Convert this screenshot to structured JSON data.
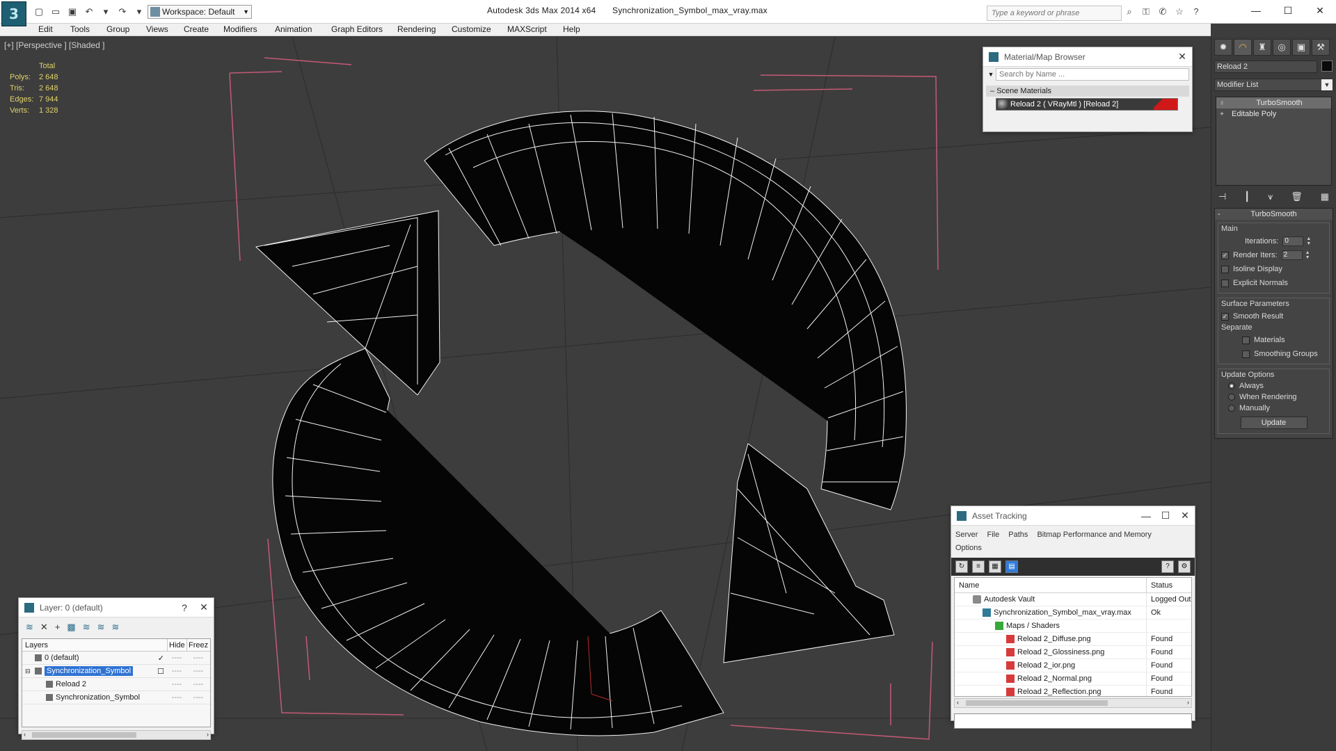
{
  "window": {
    "app_title": "Autodesk 3ds Max  2014 x64",
    "file_title": "Synchronization_Symbol_max_vray.max",
    "workspace_label": "Workspace: Default",
    "search_placeholder": "Type a keyword or phrase",
    "minimize": "—",
    "maximize": "☐",
    "close": "✕"
  },
  "menu": [
    "Edit",
    "Tools",
    "Group",
    "Views",
    "Create",
    "Modifiers",
    "Animation",
    "Graph Editors",
    "Rendering",
    "Customize",
    "MAXScript",
    "Help"
  ],
  "viewport": {
    "label": "[+] [Perspective ] [Shaded ]",
    "stats_header": "Total",
    "stats": [
      {
        "label": "Polys:",
        "value": "2 648"
      },
      {
        "label": "Tris:",
        "value": "2 648"
      },
      {
        "label": "Edges:",
        "value": "7 944"
      },
      {
        "label": "Verts:",
        "value": "1 328"
      }
    ]
  },
  "material_browser": {
    "title": "Material/Map Browser",
    "search_placeholder": "Search by Name ...",
    "section": "Scene Materials",
    "item": "Reload 2  ( VRayMtl )  [Reload 2]"
  },
  "command_panel": {
    "object_name": "Reload 2",
    "modifier_list": "Modifier List",
    "stack": [
      "TurboSmooth",
      "Editable Poly"
    ],
    "rollout_title": "TurboSmooth",
    "main_group": "Main",
    "iterations_label": "Iterations:",
    "iterations_value": "0",
    "render_iters_label": "Render Iters:",
    "render_iters_value": "2",
    "render_iters_checked": true,
    "isoline_display": "Isoline Display",
    "explicit_normals": "Explicit Normals",
    "surface_group": "Surface Parameters",
    "smooth_result": "Smooth Result",
    "separate_label": "Separate",
    "materials": "Materials",
    "smoothing_groups": "Smoothing Groups",
    "update_group": "Update Options",
    "always": "Always",
    "when_rendering": "When Rendering",
    "manually": "Manually",
    "update_button": "Update"
  },
  "layer_panel": {
    "title": "Layer: 0 (default)",
    "help": "?",
    "close": "✕",
    "col_layers": "Layers",
    "col_hide": "Hide",
    "col_freeze": "Freez",
    "rows": [
      {
        "name": "0 (default)",
        "indent": 0,
        "selected": false,
        "check": "✓"
      },
      {
        "name": "Synchronization_Symbol",
        "indent": 0,
        "selected": true,
        "check": "☐"
      },
      {
        "name": "Reload 2",
        "indent": 1,
        "selected": false,
        "check": ""
      },
      {
        "name": "Synchronization_Symbol",
        "indent": 1,
        "selected": false,
        "check": ""
      }
    ],
    "dash": "----"
  },
  "asset_tracking": {
    "title": "Asset Tracking",
    "menu": [
      "Server",
      "File",
      "Paths",
      "Bitmap Performance and Memory",
      "Options"
    ],
    "col_name": "Name",
    "col_status": "Status",
    "rows": [
      {
        "name": "Autodesk Vault",
        "status": "Logged Out",
        "indent": 1,
        "icon": "vault"
      },
      {
        "name": "Synchronization_Symbol_max_vray.max",
        "status": "Ok",
        "indent": 2,
        "icon": "max"
      },
      {
        "name": "Maps / Shaders",
        "status": "",
        "indent": 3,
        "icon": "maps"
      },
      {
        "name": "Reload 2_Diffuse.png",
        "status": "Found",
        "indent": 4,
        "icon": "png"
      },
      {
        "name": "Reload 2_Glossiness.png",
        "status": "Found",
        "indent": 4,
        "icon": "png"
      },
      {
        "name": "Reload 2_ior.png",
        "status": "Found",
        "indent": 4,
        "icon": "png"
      },
      {
        "name": "Reload 2_Normal.png",
        "status": "Found",
        "indent": 4,
        "icon": "png"
      },
      {
        "name": "Reload 2_Reflection.png",
        "status": "Found",
        "indent": 4,
        "icon": "png"
      }
    ]
  }
}
